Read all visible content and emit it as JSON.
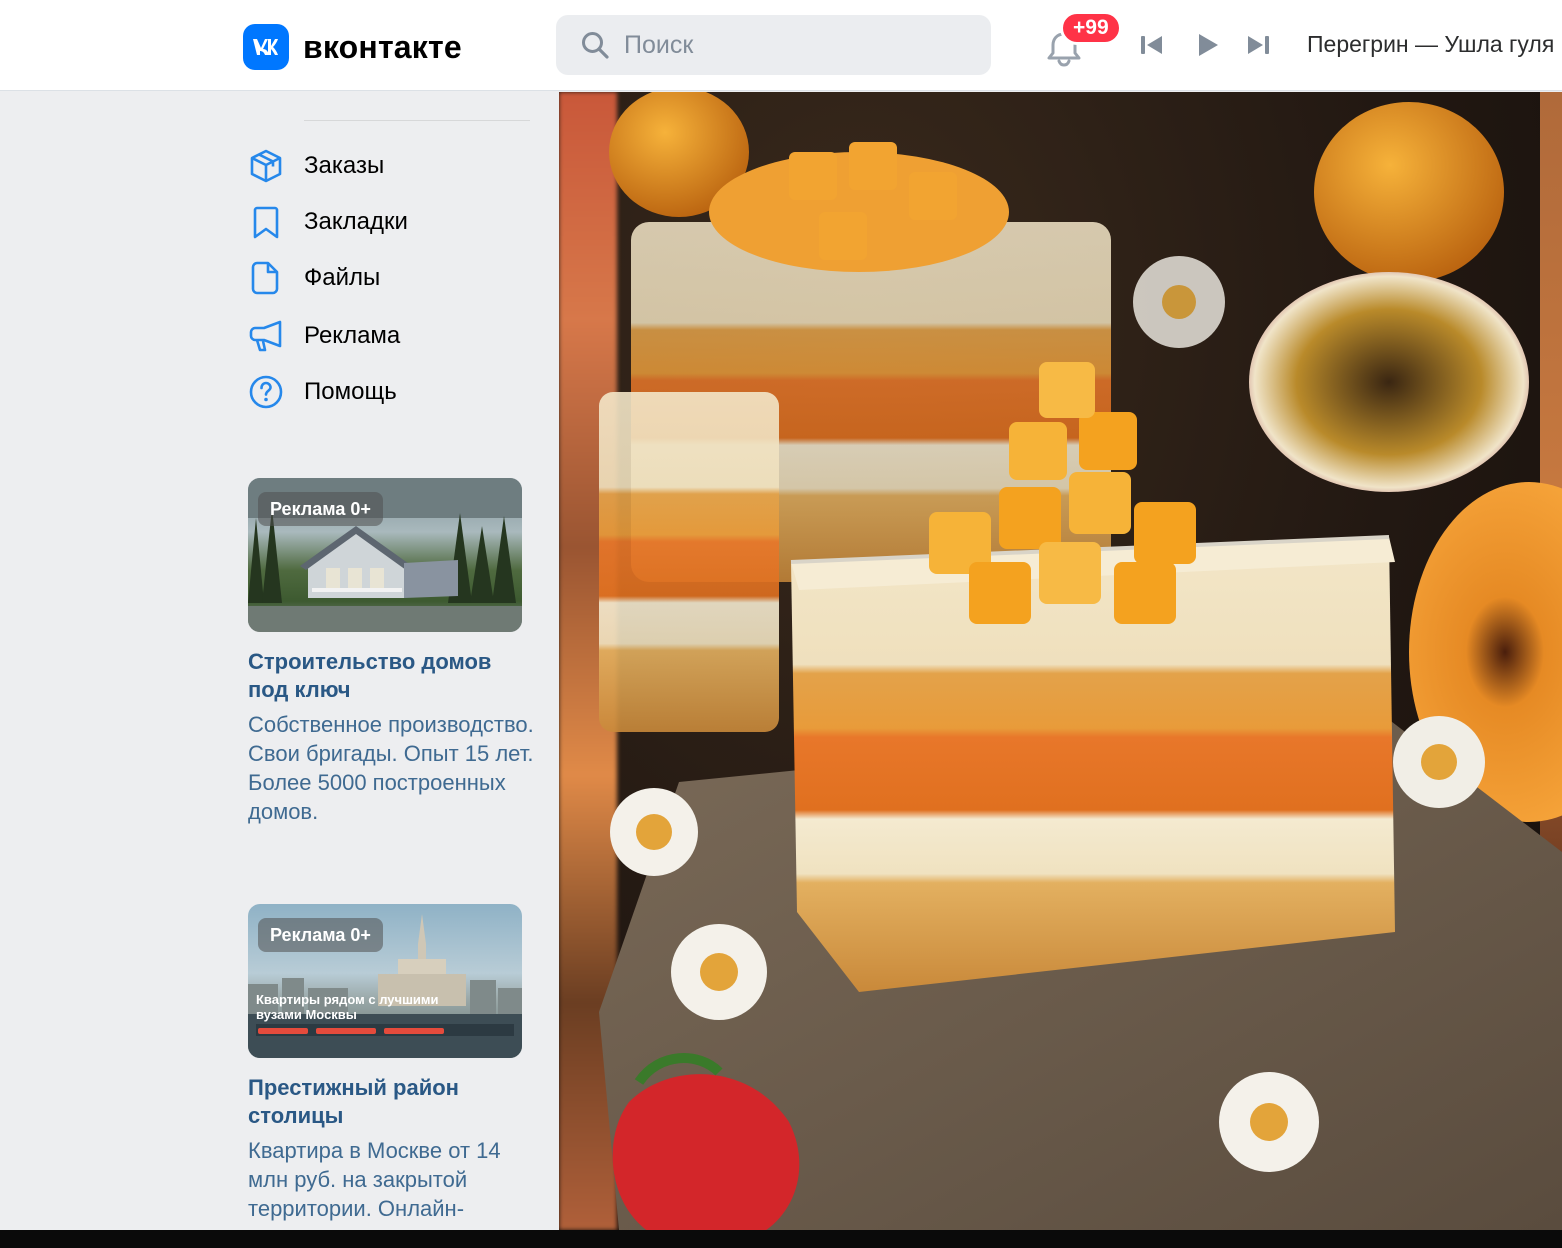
{
  "header": {
    "logo_text": "вконтакте",
    "search_placeholder": "Поиск",
    "notifications_badge": "+99",
    "now_playing": "Перегрин — Ушла гуля"
  },
  "sidebar": {
    "items": [
      {
        "label": "Заказы",
        "icon": "box-icon"
      },
      {
        "label": "Закладки",
        "icon": "bookmark-icon"
      },
      {
        "label": "Файлы",
        "icon": "file-icon"
      },
      {
        "label": "Реклама",
        "icon": "megaphone-icon"
      },
      {
        "label": "Помощь",
        "icon": "help-icon"
      }
    ]
  },
  "ads": [
    {
      "chip": "Реклама 0+",
      "title": "Строительство домов под ключ",
      "description": "Собственное производство. Свои бригады. Опыт 15 лет. Более 5000 построенных домов."
    },
    {
      "chip": "Реклама 0+",
      "image_caption": "Квартиры рядом с лучшими вузами Москвы",
      "title": "Престижный район столицы",
      "description": "Квартира в Москве от 14 млн руб. на закрытой территории. Онлайн-"
    }
  ],
  "colors": {
    "accent": "#0077ff",
    "link": "#2a5885",
    "badge": "#ff3347",
    "icon": "#2688eb"
  }
}
